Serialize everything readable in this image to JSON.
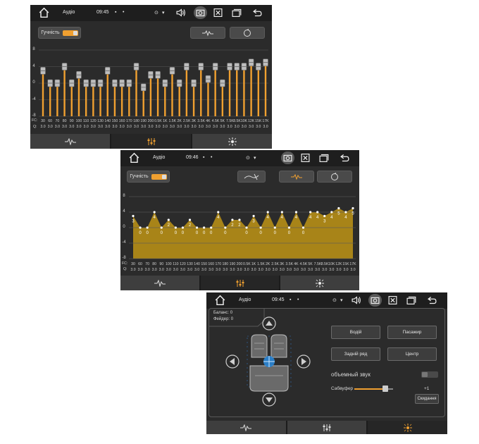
{
  "screens": [
    {
      "title": "Аудіо",
      "time": "09:45",
      "loudness_label": "Гучність",
      "loudness_on": true
    },
    {
      "title": "Аудіо",
      "time": "09:46",
      "loudness_label": "Гучність",
      "loudness_on": true
    },
    {
      "title": "Аудіо",
      "time": "09:45",
      "balance_text": "Баланс: 0",
      "fader_text": "Фейдер: 0",
      "buttons": {
        "driver": "Водій",
        "passenger": "Пасажир",
        "rear": "Задній ряд",
        "center": "Центр",
        "reset": "Скидання"
      },
      "surround_label": "объемный звук",
      "surround_on": false,
      "subwoofer_label": "Сабвуфер",
      "subwoofer_value": "+1"
    }
  ],
  "eq": {
    "fc_label": "FC:",
    "q_label": "Q:",
    "y_ticks": [
      "8",
      "4",
      "0",
      "-4",
      "-8"
    ],
    "bands": [
      "30",
      "60",
      "70",
      "80",
      "90",
      "100",
      "110",
      "120",
      "130",
      "140",
      "150",
      "160",
      "170",
      "180",
      "190",
      "200",
      "0.5K",
      "1K",
      "1.5K",
      "2K",
      "2.5K",
      "3K",
      "3.5K",
      "4K",
      "4.5K",
      "5K",
      "7.5K",
      "8.5K",
      "10K",
      "12K",
      "15K",
      "17K"
    ],
    "q": [
      "3.0",
      "3.0",
      "3.0",
      "3.0",
      "3.0",
      "3.0",
      "3.0",
      "3.0",
      "3.0",
      "3.0",
      "3.0",
      "3.0",
      "3.0",
      "3.0",
      "3.0",
      "3.0",
      "3.0",
      "3.0",
      "3.0",
      "3.0",
      "3.0",
      "3.0",
      "3.0",
      "3.0",
      "3.0",
      "3.0",
      "3.0",
      "3.0",
      "3.0",
      "3.0",
      "3.0",
      "3.0"
    ]
  },
  "chart_data": [
    {
      "type": "bar",
      "ylim": [
        -8,
        8
      ],
      "categories": [
        "30",
        "60",
        "70",
        "80",
        "90",
        "100",
        "110",
        "120",
        "130",
        "140",
        "150",
        "160",
        "170",
        "180",
        "190",
        "200",
        "0.5K",
        "1K",
        "1.5K",
        "2K",
        "2.5K",
        "3K",
        "3.5K",
        "4K",
        "4.5K",
        "5K",
        "7.5K",
        "8.5K",
        "10K",
        "12K",
        "15K",
        "17K"
      ],
      "values": [
        3,
        0,
        0,
        4,
        0,
        2,
        0,
        0,
        0,
        3,
        0,
        0,
        0,
        4,
        -1,
        2,
        2,
        0,
        3,
        0,
        4,
        0,
        4,
        1,
        4,
        0,
        4,
        4,
        4,
        5,
        4,
        5
      ]
    },
    {
      "type": "area",
      "ylim": [
        -8,
        8
      ],
      "categories": [
        "30",
        "60",
        "70",
        "80",
        "90",
        "100",
        "110",
        "120",
        "130",
        "140",
        "150",
        "160",
        "170",
        "180",
        "190",
        "200",
        "0.5K",
        "1K",
        "1.5K",
        "2K",
        "2.5K",
        "3K",
        "3.5K",
        "4K",
        "4.5K",
        "5K",
        "7.5K",
        "8.5K",
        "10K",
        "12K",
        "15K",
        "17K"
      ],
      "values": [
        3,
        0,
        0,
        4,
        0,
        2,
        0,
        0,
        2,
        0,
        0,
        0,
        4,
        0,
        2,
        2,
        0,
        3,
        0,
        4,
        0,
        4,
        0,
        4,
        0,
        4,
        4,
        3,
        4,
        5,
        4,
        5
      ],
      "point_labels": [
        "3",
        "0",
        "0",
        "4",
        "0",
        "2",
        "0",
        "0",
        "2",
        "0",
        "0",
        "0",
        "4",
        "0",
        "2",
        "2",
        "0",
        "3",
        "0",
        "4",
        "0",
        "4",
        "0",
        "4",
        "0",
        "4",
        "4",
        "3",
        "4",
        "5",
        "4",
        "5"
      ]
    }
  ],
  "colors": {
    "accent": "#f0a030",
    "fill": "#a88418",
    "bg": "#2b2b2b"
  }
}
